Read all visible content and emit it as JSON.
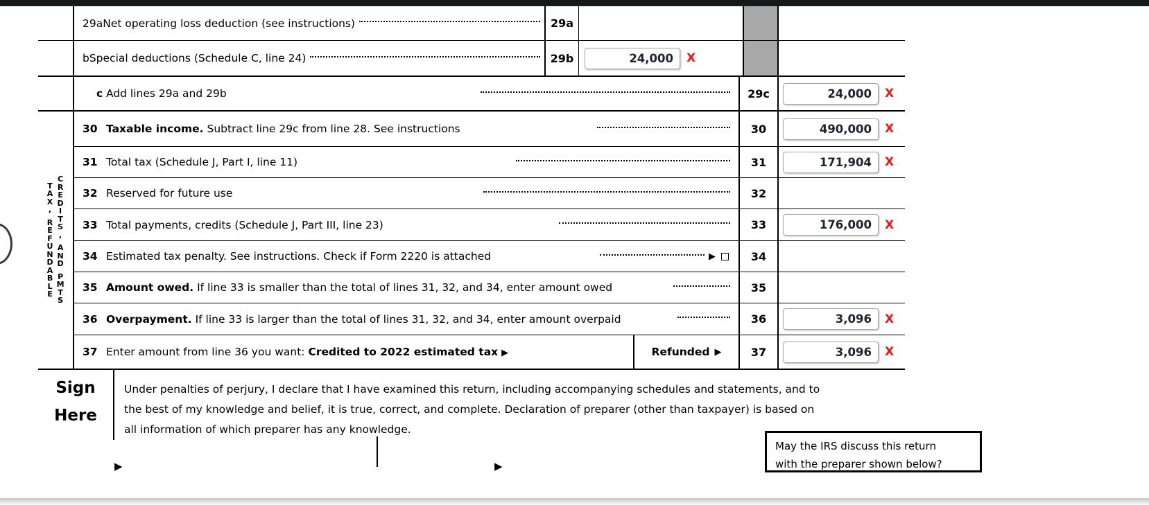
{
  "document": {
    "form_name": "Form 1120 U.S. Corporation Income Tax Return (page 1, lines 29a-37)",
    "rail_label_col1": "TAX, REFUNDABLE",
    "rail_label_col2": "CREDITS, AND PMTS"
  },
  "rail": {
    "col_left": [
      "T",
      "A",
      "X",
      ",",
      "",
      "R",
      "E",
      "F",
      "U",
      "N",
      "D",
      "A",
      "B",
      "L",
      "E"
    ],
    "col_right": [
      "C",
      "R",
      "E",
      "D",
      "I",
      "T",
      "S",
      ",",
      "",
      "A",
      "N",
      "D",
      "",
      "P",
      "M",
      "T",
      "S"
    ]
  },
  "lines": [
    {
      "id": "29a",
      "number": "29a",
      "number_indent": false,
      "text": "Net operating loss deduction (see instructions)",
      "text_bold_prefix": "",
      "stub": "29a",
      "value": "",
      "has_value": false,
      "flag": ""
    },
    {
      "id": "29b",
      "number": "b",
      "number_indent": true,
      "text": "Special deductions (Schedule C, line 24)",
      "text_bold_prefix": "",
      "stub": "29b",
      "value": "24,000",
      "has_value": true,
      "flag": "X"
    },
    {
      "id": "29c",
      "number": "c",
      "number_indent": true,
      "text": "Add lines 29a and 29b",
      "text_bold_prefix": "",
      "stub": "29c",
      "value": "24,000",
      "has_value": true,
      "flag": "X"
    },
    {
      "id": "30",
      "number": "30",
      "number_indent": false,
      "text": "Subtract line 29c from line 28. See instructions",
      "text_bold_prefix": "Taxable income.",
      "stub": "30",
      "value": "490,000",
      "has_value": true,
      "flag": "X"
    },
    {
      "id": "31",
      "number": "31",
      "number_indent": false,
      "text": "Total tax (Schedule J, Part I, line 11)",
      "text_bold_prefix": "",
      "stub": "31",
      "value": "171,904",
      "has_value": true,
      "flag": "X"
    },
    {
      "id": "32",
      "number": "32",
      "number_indent": false,
      "text": "Reserved for future use",
      "text_bold_prefix": "",
      "stub": "32",
      "value": "",
      "has_value": false,
      "flag": ""
    },
    {
      "id": "33",
      "number": "33",
      "number_indent": false,
      "text": "Total payments, credits (Schedule J, Part III, line 23)",
      "text_bold_prefix": "",
      "stub": "33",
      "value": "176,000",
      "has_value": true,
      "flag": "X"
    },
    {
      "id": "34",
      "number": "34",
      "number_indent": false,
      "text": "Estimated tax penalty. See instructions. Check if Form 2220 is attached",
      "text_bold_prefix": "",
      "stub": "34",
      "value": "",
      "has_value": false,
      "flag": "",
      "has_checkbox": true
    },
    {
      "id": "35",
      "number": "35",
      "number_indent": false,
      "text": "If line 33 is smaller than the total of lines 31, 32, and 34, enter amount owed",
      "text_bold_prefix": "Amount owed.",
      "stub": "35",
      "value": "",
      "has_value": false,
      "flag": ""
    },
    {
      "id": "36",
      "number": "36",
      "number_indent": false,
      "text": "If line 33 is larger than the total of lines 31, 32, and 34, enter amount overpaid",
      "text_bold_prefix": "Overpayment.",
      "stub": "36",
      "value": "3,096",
      "has_value": true,
      "flag": "X"
    }
  ],
  "line37": {
    "number": "37",
    "text_plain": "Enter amount from line 36 you want:",
    "text_bold": "Credited to 2022 estimated tax",
    "arrow": "▶",
    "refunded_label": "Refunded",
    "refunded_arrow": "▶",
    "stub": "37",
    "value": "3,096",
    "flag": "X"
  },
  "sign": {
    "heading_line1": "Sign",
    "heading_line2": "Here",
    "perjury_line1": "Under penalties of perjury, I declare that I have examined this return, including accompanying schedules and statements, and to",
    "perjury_line2": "the best of my knowledge and belief, it is true, correct, and complete. Declaration of preparer (other than taxpayer) is based on",
    "perjury_line3": "all information of which preparer has any knowledge.",
    "arrow1": "▶",
    "arrow2": "▶"
  },
  "irs_box": {
    "line1": "May the IRS discuss this return",
    "line2": "with the preparer shown below?"
  },
  "colors": {
    "flag_red": "#f01414",
    "shaded_cell": "#a8a8a8",
    "input_value": "#1c2330",
    "rule": "#000000"
  }
}
